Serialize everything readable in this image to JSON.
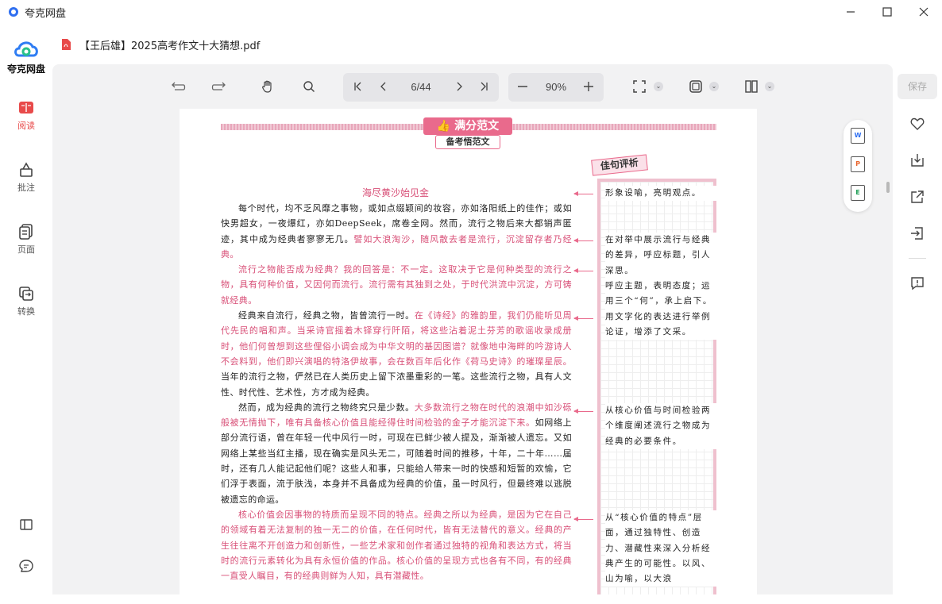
{
  "app": {
    "title": "夸克网盘",
    "brand_name": "夸克网盘",
    "accent_color": "#e84a4a"
  },
  "window_controls": [
    {
      "name": "minimize-icon",
      "glyph": "—"
    },
    {
      "name": "maximize-icon",
      "glyph": "☐"
    },
    {
      "name": "close-icon",
      "glyph": "✕"
    }
  ],
  "sidebar": {
    "items": [
      {
        "label": "阅读",
        "icon": "read-icon",
        "active": true
      },
      {
        "label": "批注",
        "icon": "annotate-icon",
        "active": false
      },
      {
        "label": "页面",
        "icon": "pages-icon",
        "active": false
      },
      {
        "label": "转换",
        "icon": "convert-icon",
        "active": false
      }
    ]
  },
  "file": {
    "name": "【王后雄】2025高考作文十大猜想.pdf",
    "type_icon": "pdf-icon"
  },
  "toolbar": {
    "page_indicator": "6/44",
    "zoom": "90%",
    "save_label": "保存"
  },
  "document": {
    "badge": "满分范文",
    "badge_sub": "备考悟范文",
    "remark_head": "佳句评析",
    "essay_title": "海尽黄沙始见金",
    "paragraphs": [
      {
        "plain1": "每个时代，均不乏风靡之事物，或如点缀颖间的妆容，亦如洛阳纸上的佳作；或如快男超女，一夜爆红，亦如DeepSeek，席卷全网。然而，流行之物后来大都销声匿迹，其中成为经典者寥寥无几。",
        "red1": "譬如大浪淘沙，随风散去者是流行，沉淀留存者乃经典。",
        "plain2": "",
        "red2": "",
        "plain3": ""
      },
      {
        "plain1": "",
        "red1": "流行之物能否成为经典？我的回答是：不一定。这取决于它是何种类型的流行之物，具有何种价值，又因何而流行。流行需有其独到之处，于时代洪流中沉淀，方可铸就经典。",
        "plain2": "",
        "red2": "",
        "plain3": ""
      },
      {
        "plain1": "经典来自流行，经典之物，皆曾流行一时。",
        "red1": "在《诗经》的雅韵里，我们仍能听见周代先民的唱和声。当采诗官摇着木铎穿行阡陌，将这些沾着泥土芬芳的歌谣收录成册时，他们何曾想到这些俚俗小调会成为中华文明的基因图谱？就像地中海畔的吟游诗人不会料到，他们即兴演唱的特洛伊故事，会在数百年后化作《荷马史诗》的璀璨星辰。",
        "plain2": "当年的流行之物，俨然已在人类历史上留下浓墨重彩的一笔。这些流行之物，具有人文性、时代性、艺术性，方才成为经典。",
        "red2": "",
        "plain3": ""
      },
      {
        "plain1": "然而，成为经典的流行之物终究只是少数。",
        "red1": "大多数流行之物在时代的浪潮中如沙砾般被无情抛下，唯有具备核心价值且能经得住时间检验的金子才能沉淀下来。",
        "plain2": "如网络上部分流行语，曾在年轻一代中风行一时，可现在已鲜少被人提及，渐渐被人遗忘。又如网络上某些当红主播，现在确实是风头无二，可随着时间的推移，十年，二十年……届时，还有几人能记起他们呢？这些人和事，只能给人带来一时的快感和短暂的欢愉，它们浮于表面，流于肤浅，本身并不具备成为经典的价值，虽一时风行，但最终难以逃脱被遗忘的命运。",
        "red2": "",
        "plain3": ""
      },
      {
        "plain1": "",
        "red1": "核心价值会因事物的特质而呈现不同的特点。经典之所以为经典，是因为它在自己的领域有着无法复制的独一无二的价值，在任何时代，皆有无法替代的意义。经典的产生往往离不开创造力和创新性，一些艺术家和创作者通过独特的视角和表达方式，将当时的流行元素转化为具有永恒价值的作品。核心价值的呈现方式也各有不同，有的经典一直受人瞩目，有的经典则鲜为人知，具有潜藏性。",
        "plain2": "",
        "red2": "",
        "plain3": ""
      }
    ],
    "remarks": [
      "形象设喻，亮明观点。",
      "在对举中展示流行与经典的差异，呼应标题，引人深思。",
      "呼应主题，表明态度；运用三个“何”，承上启下。用文字化的表达进行举例论证，增添了文采。",
      "从核心价值与时间检验两个维度阐述流行之物成为经典的必要条件。",
      "从“核心价值的特点”层面，通过独特性、创造力、潜藏性来深入分析经典产生的可能性。以风、山为喻，以大浪"
    ]
  },
  "float_tools": [
    {
      "icon": "to-word-icon",
      "letter": "W",
      "color": "#2f6ff0"
    },
    {
      "icon": "to-ppt-icon",
      "letter": "P",
      "color": "#e8642c"
    },
    {
      "icon": "to-excel-icon",
      "letter": "E",
      "color": "#1f9d55"
    }
  ],
  "right_panel": [
    {
      "icon": "favorite-icon"
    },
    {
      "icon": "download-icon"
    },
    {
      "icon": "share-icon"
    },
    {
      "icon": "open-external-icon"
    },
    {
      "icon": "report-icon"
    }
  ]
}
